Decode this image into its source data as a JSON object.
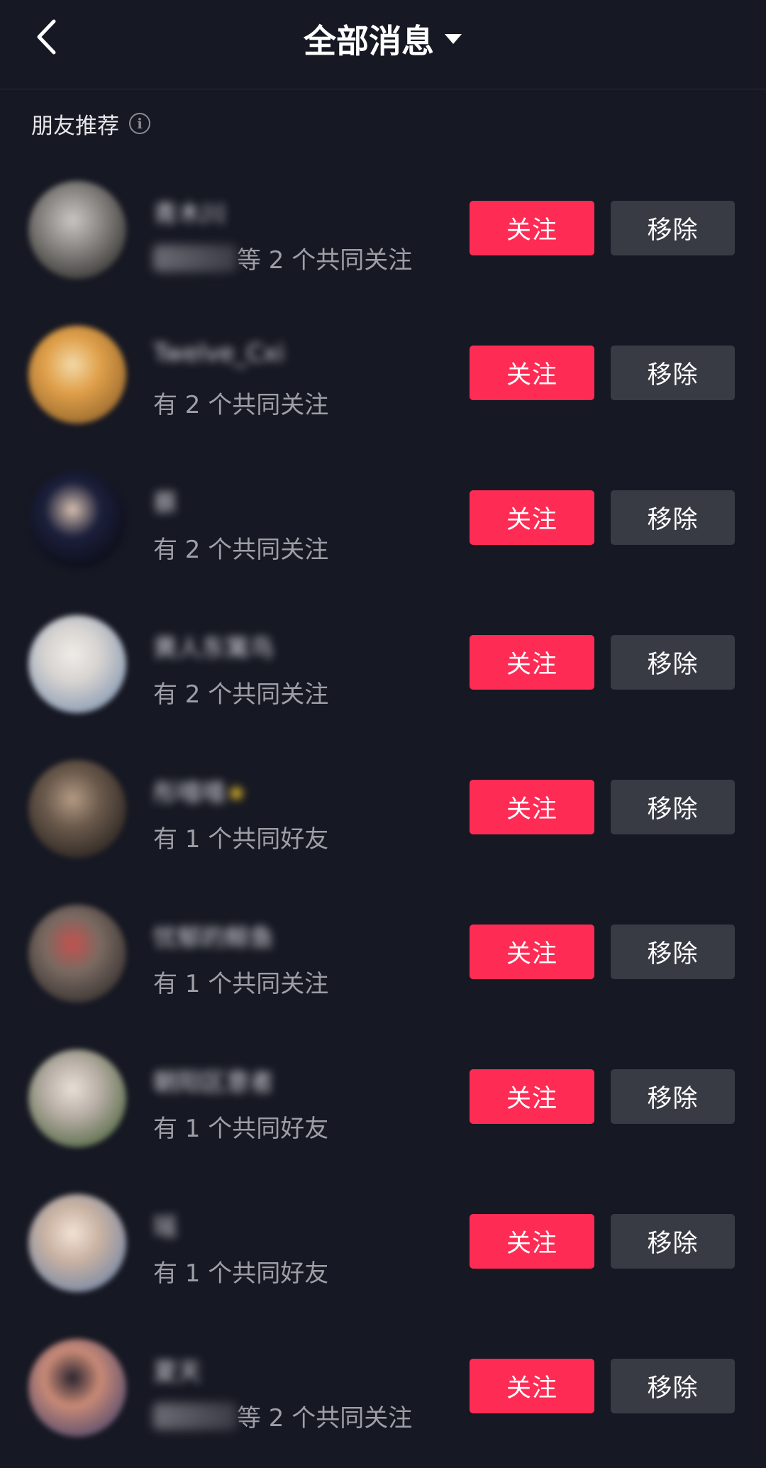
{
  "header": {
    "title": "全部消息",
    "back_icon": "chevron-left-icon",
    "dropdown_icon": "caret-down-icon"
  },
  "section": {
    "label": "朋友推荐",
    "info_icon": "info-icon",
    "info_glyph": "i"
  },
  "buttons": {
    "follow": "关注",
    "remove": "移除"
  },
  "colors": {
    "background": "#161823",
    "follow": "#fe2c55",
    "remove": "#393b44"
  },
  "users": [
    {
      "name": "青木川",
      "star": "",
      "subtitle_prefix_blurred": true,
      "subtitle": "等 2 个共同关注",
      "avatar_colors": [
        "#8d8a86",
        "#3b3a38",
        "#c8c6c3"
      ]
    },
    {
      "name": "Twelve_Cxi",
      "star": "",
      "subtitle_prefix_blurred": false,
      "subtitle": "有 2 个共同关注",
      "avatar_colors": [
        "#e0a04a",
        "#9a6a2e",
        "#f2d9a8"
      ]
    },
    {
      "name": "蔡",
      "star": "",
      "subtitle_prefix_blurred": false,
      "subtitle": "有 2 个共同关注",
      "avatar_colors": [
        "#1b1f3a",
        "#0c0d18",
        "#d8c0b0"
      ]
    },
    {
      "name": "黄人东篱鸟",
      "star": "",
      "subtitle_prefix_blurred": false,
      "subtitle": "有 2 个共同关注",
      "avatar_colors": [
        "#d6d3d0",
        "#8a9bb4",
        "#f0ece8"
      ]
    },
    {
      "name": "彤嘻嘻",
      "star": "★",
      "subtitle_prefix_blurred": false,
      "subtitle": "有 1 个共同好友",
      "avatar_colors": [
        "#6b5a4c",
        "#2e2723",
        "#b49a84"
      ]
    },
    {
      "name": "忧郁的鲸鱼",
      "star": "",
      "subtitle_prefix_blurred": false,
      "subtitle": "有 1 个共同关注",
      "avatar_colors": [
        "#7a6a62",
        "#3a3432",
        "#c2524e"
      ]
    },
    {
      "name": "朝阳区意者",
      "star": "",
      "subtitle_prefix_blurred": false,
      "subtitle": "有 1 个共同好友",
      "avatar_colors": [
        "#b8aea6",
        "#5a6e4a",
        "#e8e0d8"
      ]
    },
    {
      "name": "瑶",
      "star": "",
      "subtitle_prefix_blurred": false,
      "subtitle": "有 1 个共同好友",
      "avatar_colors": [
        "#c9b2a2",
        "#7a8aa6",
        "#f2e2d6"
      ]
    },
    {
      "name": "夏天",
      "star": "",
      "subtitle_prefix_blurred": true,
      "subtitle": "等 2 个共同关注",
      "avatar_colors": [
        "#c98a76",
        "#5a4e6e",
        "#2a2430"
      ]
    }
  ]
}
